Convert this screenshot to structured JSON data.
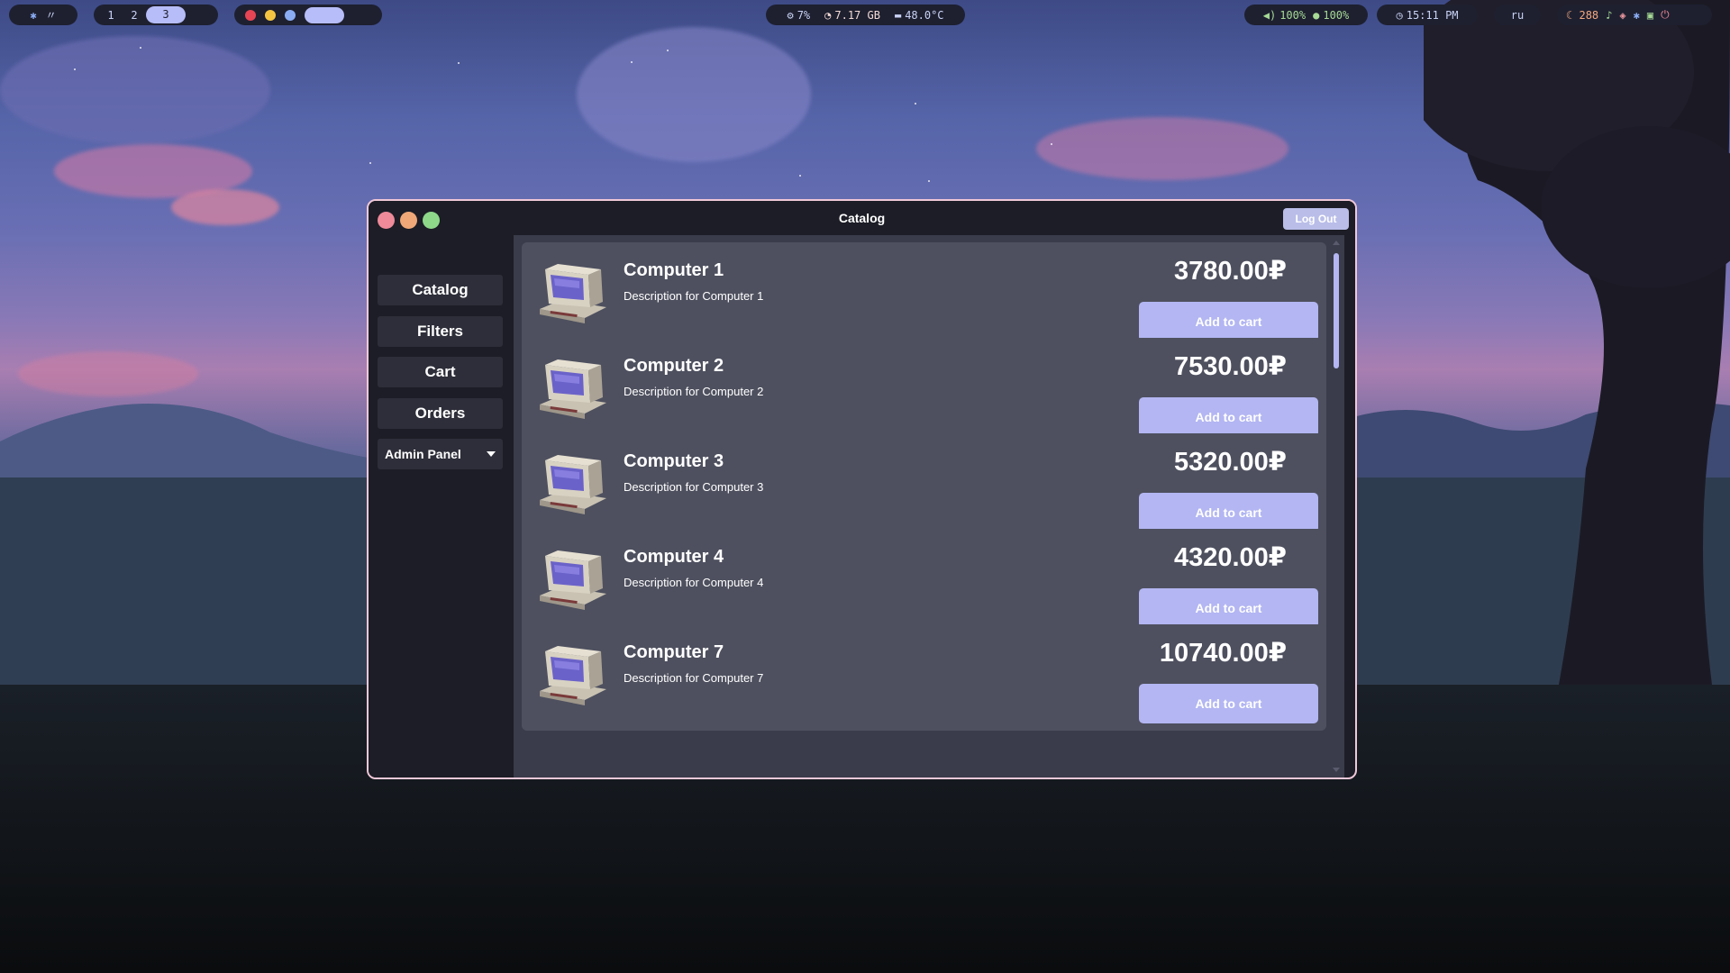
{
  "topbar": {
    "workspaces": [
      "1",
      "2",
      "3"
    ],
    "active_workspace": "3",
    "cpu": "7%",
    "memory": "7.17 GB",
    "temperature": "48.0°C",
    "volume": "100%",
    "mic": "100%",
    "clock": "15:11 PM",
    "keyboard_layout": "ru",
    "updates": "288"
  },
  "window": {
    "title": "Catalog",
    "logout_label": "Log Out"
  },
  "sidebar": {
    "items": [
      {
        "label": "Catalog"
      },
      {
        "label": "Filters"
      },
      {
        "label": "Cart"
      },
      {
        "label": "Orders"
      }
    ],
    "admin_dropdown": "Admin Panel"
  },
  "products": [
    {
      "name": "Computer 1",
      "description": "Description for Computer 1",
      "price": "3780.00₽",
      "button": "Add to cart"
    },
    {
      "name": "Computer 2",
      "description": "Description for Computer 2",
      "price": "7530.00₽",
      "button": "Add to cart"
    },
    {
      "name": "Computer 3",
      "description": "Description for Computer 3",
      "price": "5320.00₽",
      "button": "Add to cart"
    },
    {
      "name": "Computer 4",
      "description": "Description for Computer 4",
      "price": "4320.00₽",
      "button": "Add to cart"
    },
    {
      "name": "Computer 7",
      "description": "Description for Computer 7",
      "price": "10740.00₽",
      "button": "Add to cart"
    }
  ],
  "colors": {
    "accent": "#b3b6f2",
    "window_border": "#f0c8d8",
    "close": "#ee8a9a",
    "minimize": "#f0a878",
    "maximize": "#8ed88a"
  }
}
